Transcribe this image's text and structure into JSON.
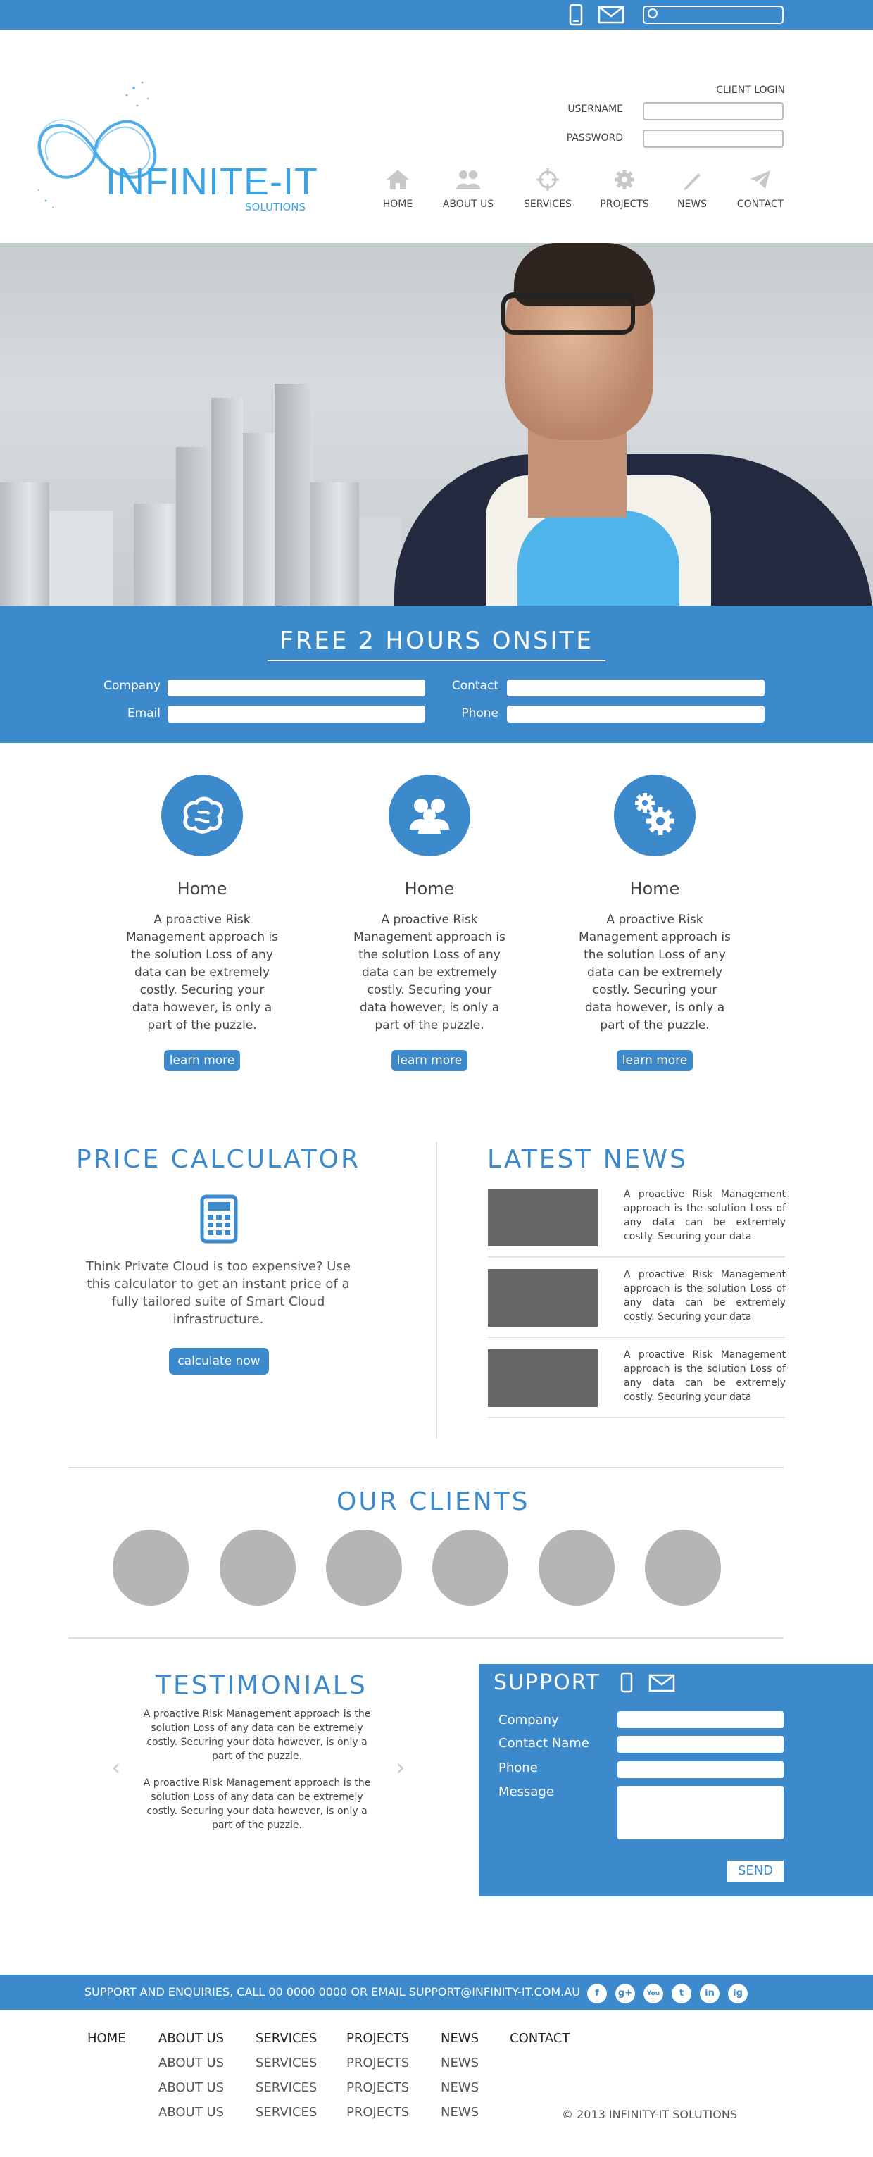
{
  "topbar": {
    "search_placeholder": ""
  },
  "logo": {
    "brand": "INFINITE-IT",
    "sub": "SOLUTIONS"
  },
  "login": {
    "title": "CLIENT LOGIN",
    "username_label": "USERNAME",
    "password_label": "PASSWORD"
  },
  "nav": [
    {
      "label": "HOME",
      "icon": "home-icon"
    },
    {
      "label": "ABOUT US",
      "icon": "people-icon"
    },
    {
      "label": "SERVICES",
      "icon": "crosshair-icon"
    },
    {
      "label": "PROJECTS",
      "icon": "gear-icon"
    },
    {
      "label": "NEWS",
      "icon": "pencil-icon"
    },
    {
      "label": "CONTACT",
      "icon": "paper-plane-icon"
    }
  ],
  "free": {
    "title": "FREE 2 HOURS ONSITE",
    "company_label": "Company",
    "contact_label": "Contact",
    "email_label": "Email",
    "phone_label": "Phone"
  },
  "features": [
    {
      "icon": "brain-icon",
      "title": "Home",
      "body": "A proactive Risk Management approach is the solution Loss of any data can be extremely costly. Securing your data however, is only a part of the puzzle.",
      "button": "learn more"
    },
    {
      "icon": "users-icon",
      "title": "Home",
      "body": "A proactive Risk Management approach is the solution Loss of any data can be extremely costly. Securing your data however, is only a part of the puzzle.",
      "button": "learn more"
    },
    {
      "icon": "gears-icon",
      "title": "Home",
      "body": "A proactive Risk Management approach is the solution Loss of any data can be extremely costly. Securing your data however, is only a part of the puzzle.",
      "button": "learn more"
    }
  ],
  "price": {
    "title": "PRICE CALCULATOR",
    "text": "Think Private Cloud is too expensive? Use this calculator to get an instant price of a fully tailored suite of Smart Cloud infrastructure.",
    "button": "calculate now"
  },
  "news": {
    "title": "LATEST NEWS",
    "items": [
      {
        "text": "A proactive Risk Management approach is the solution Loss of any data can be extremely costly. Securing your data"
      },
      {
        "text": "A proactive Risk Management approach is the solution Loss of any data can be extremely costly. Securing your data"
      },
      {
        "text": "A proactive Risk Management approach is the solution Loss of any data can be extremely costly. Securing your data"
      }
    ]
  },
  "clients": {
    "title": "OUR CLIENTS"
  },
  "testimonials": {
    "title": "TESTIMONIALS",
    "quotes": [
      "A proactive Risk Management approach is the solution Loss of any data can be extremely costly. Securing your data however, is only a part of the puzzle.",
      "A proactive Risk Management approach is the solution Loss of any data can be extremely costly. Securing your data however, is only a part of the puzzle."
    ]
  },
  "support": {
    "title": "SUPPORT",
    "company_label": "Company",
    "contact_label": "Contact Name",
    "phone_label": "Phone",
    "message_label": "Message",
    "send": "SEND"
  },
  "footer": {
    "bar_text": "SUPPORT AND ENQUIRIES, CALL 00 0000 0000 OR EMAIL SUPPORT@INFINITY-IT.COM.AU",
    "social": [
      "f",
      "g+",
      "You",
      "t",
      "in",
      "ig"
    ],
    "columns": [
      {
        "head": "HOME",
        "items": []
      },
      {
        "head": "ABOUT US",
        "items": [
          "ABOUT US",
          "ABOUT US",
          "ABOUT US"
        ]
      },
      {
        "head": "SERVICES",
        "items": [
          "SERVICES",
          "SERVICES",
          "SERVICES"
        ]
      },
      {
        "head": "PROJECTS",
        "items": [
          "PROJECTS",
          "PROJECTS",
          "PROJECTS"
        ]
      },
      {
        "head": "NEWS",
        "items": [
          "NEWS",
          "NEWS",
          "NEWS"
        ]
      },
      {
        "head": "CONTACT",
        "items": []
      }
    ],
    "copyright": "© 2013 INFINITY-IT SOLUTIONS"
  },
  "colors": {
    "accent": "#3c89cc",
    "logo": "#3aa4e6",
    "thumb": "#666666",
    "client_circle": "#b5b5b5"
  }
}
